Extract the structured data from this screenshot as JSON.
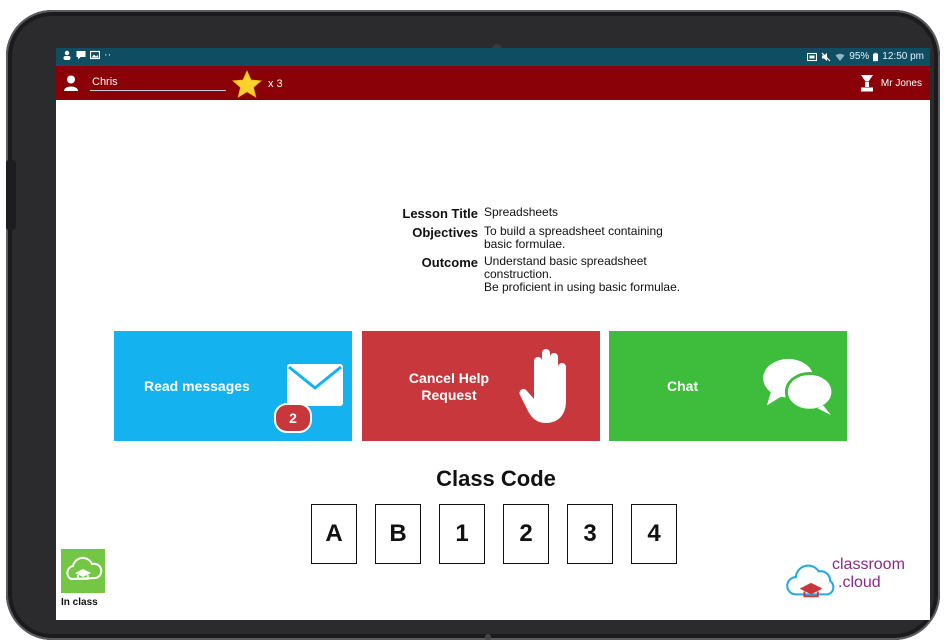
{
  "statusbar": {
    "left_icons": [
      "person-icon",
      "chat-icon",
      "image-icon",
      "more-icon"
    ],
    "battery": "95%",
    "time": "12:50 pm"
  },
  "appbar": {
    "student_name": "Chris",
    "star_count": "x 3",
    "teacher_name": "Mr Jones",
    "background_color": "#8a0208"
  },
  "lesson": {
    "title_label": "Lesson Title",
    "title_value": "Spreadsheets",
    "objectives_label": "Objectives",
    "objectives_value": "To build a spreadsheet containing basic formulae.",
    "outcome_label": "Outcome",
    "outcome_value_1": "Understand basic spreadsheet construction.",
    "outcome_value_2": "Be proficient in using basic formulae."
  },
  "tiles": {
    "read_messages_label": "Read messages",
    "read_messages_count": "2",
    "cancel_help_label_1": "Cancel Help",
    "cancel_help_label_2": "Request",
    "chat_label": "Chat",
    "colors": {
      "read": "#14b2ee",
      "help": "#c8373b",
      "chat": "#3dbd3b"
    }
  },
  "class_code": {
    "title": "Class Code",
    "chars": [
      "A",
      "B",
      "1",
      "2",
      "3",
      "4"
    ]
  },
  "footer": {
    "in_class_label": "In class",
    "logo_line1": "classroom",
    "logo_line2": ".cloud"
  }
}
